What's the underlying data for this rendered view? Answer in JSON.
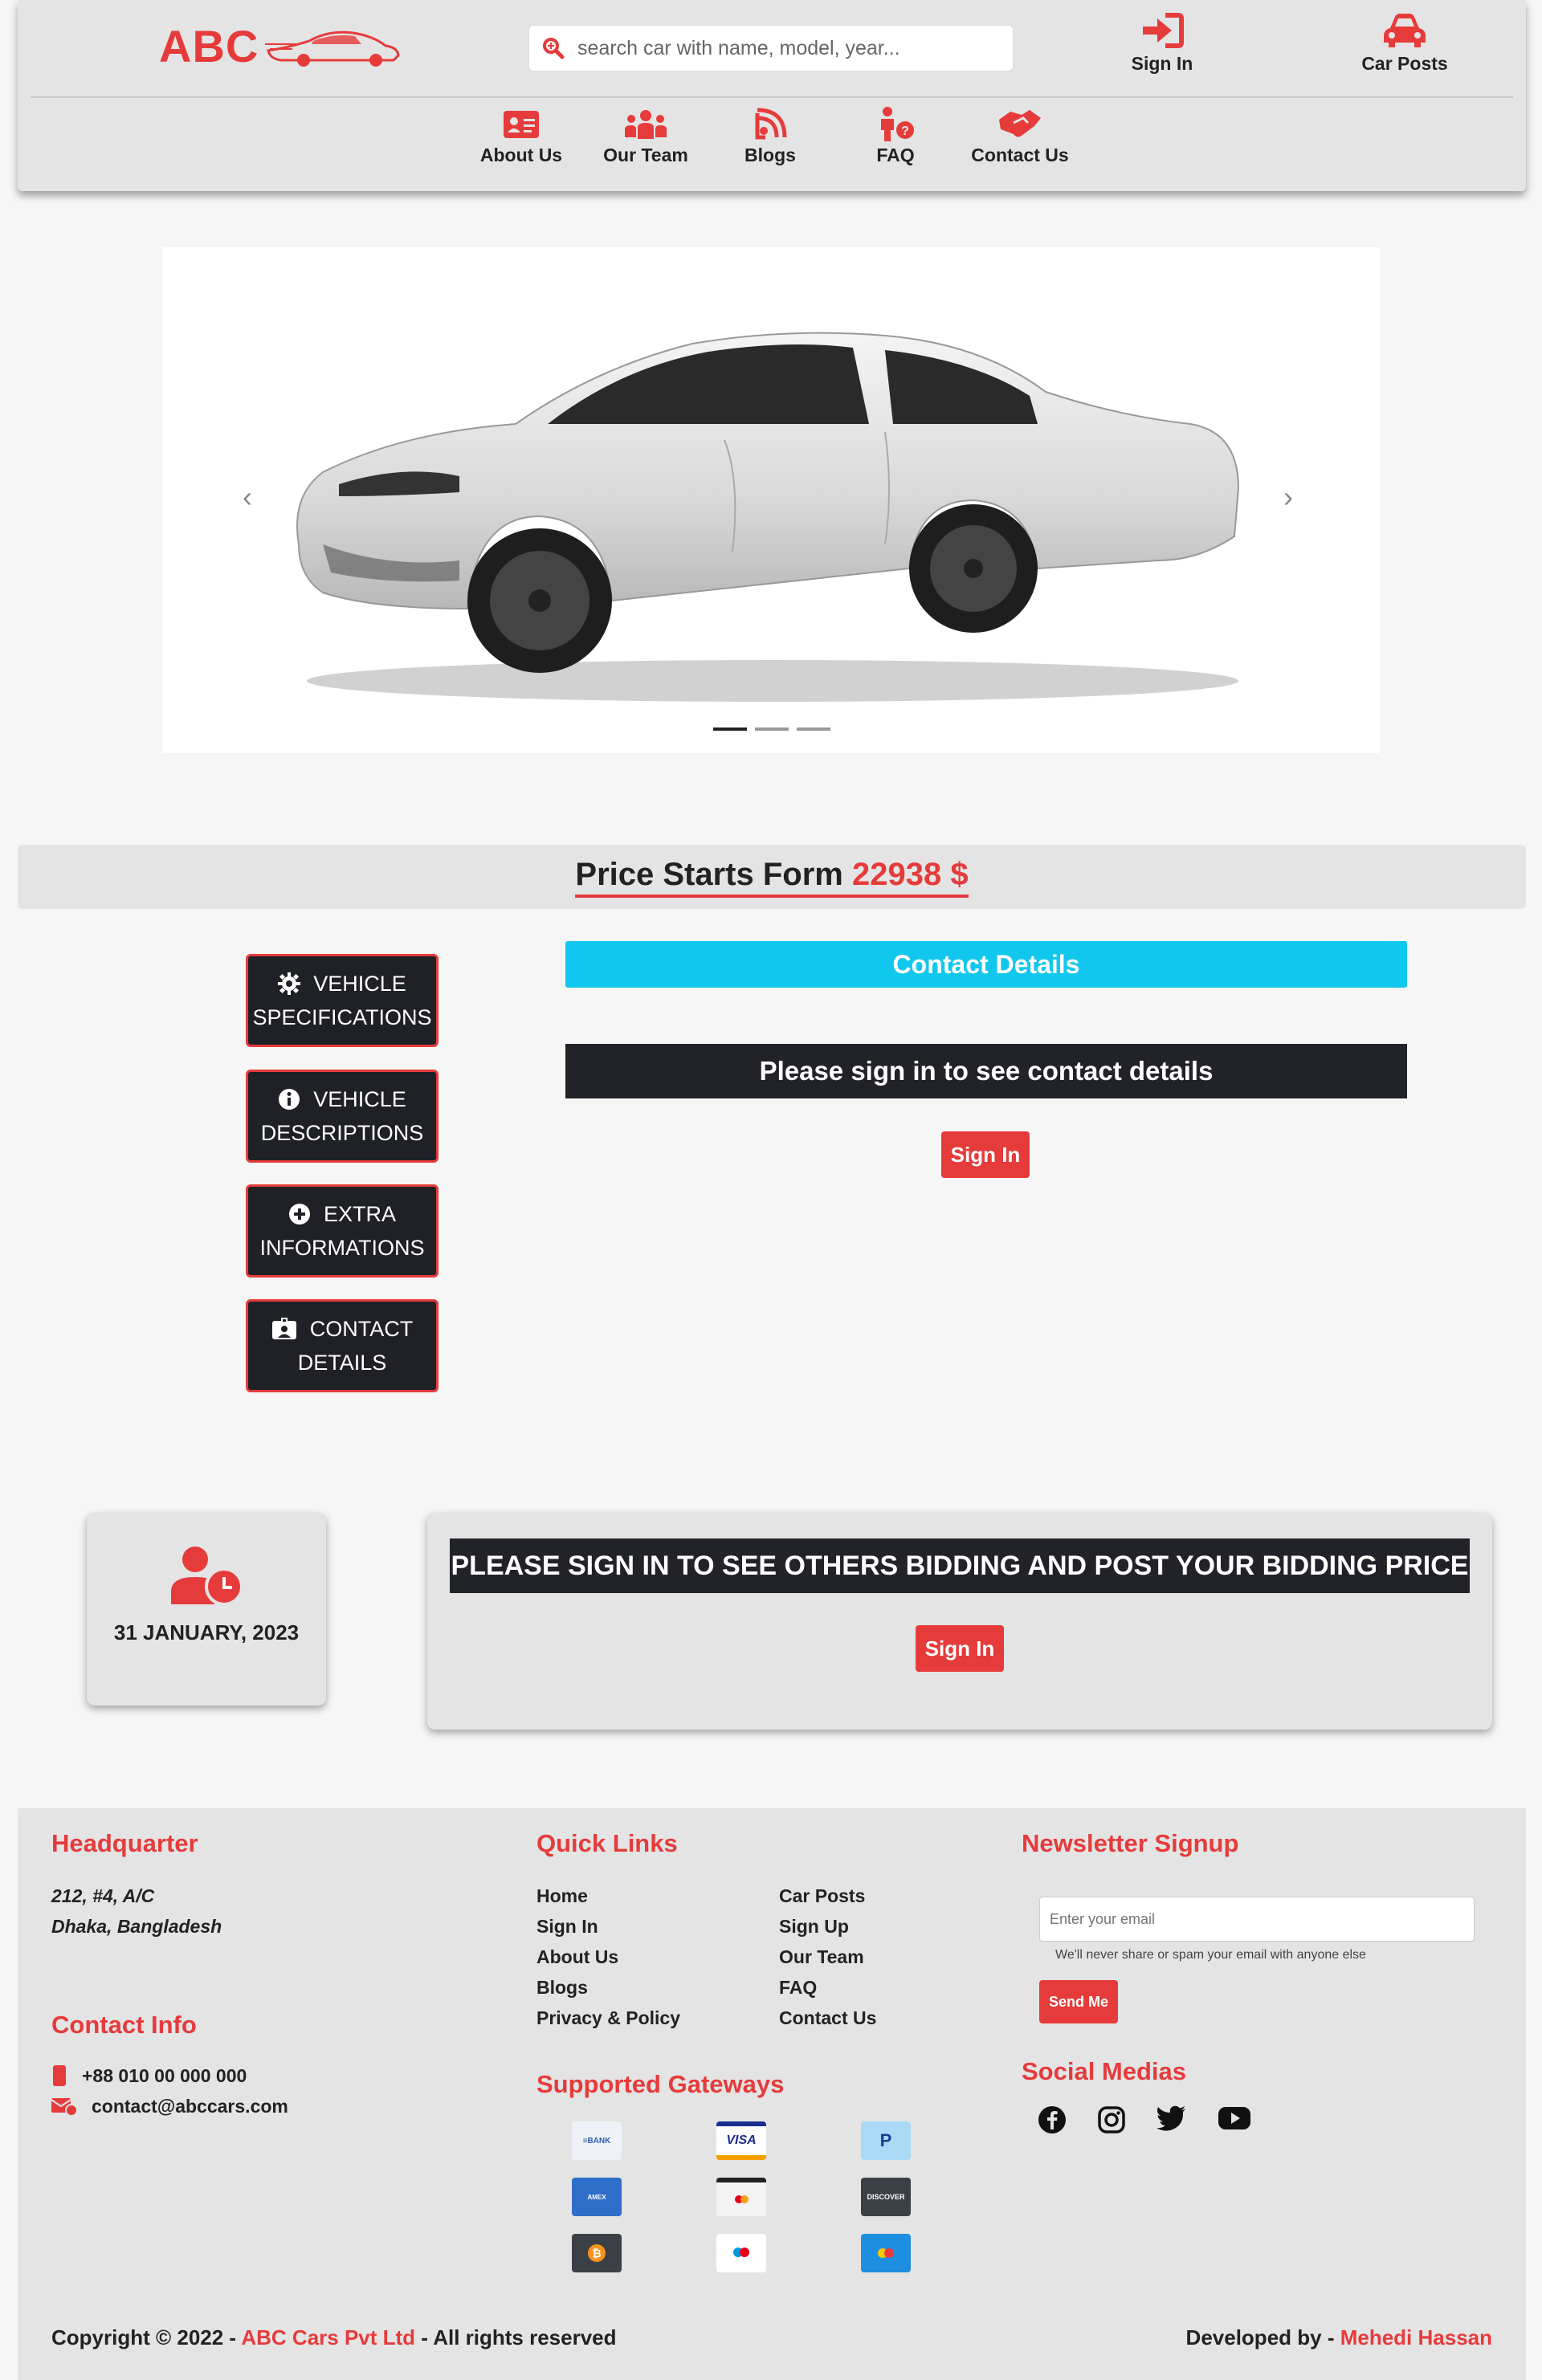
{
  "header": {
    "logo_text": "ABC",
    "search_placeholder": "search car with name, model, year...",
    "sign_in": "Sign In",
    "car_posts": "Car Posts",
    "nav": [
      {
        "label": "About Us",
        "icon": "id-card-icon"
      },
      {
        "label": "Our Team",
        "icon": "people-icon"
      },
      {
        "label": "Blogs",
        "icon": "rss-icon"
      },
      {
        "label": "FAQ",
        "icon": "person-question-icon"
      },
      {
        "label": "Contact Us",
        "icon": "handshake-icon"
      }
    ]
  },
  "carousel": {
    "prev": "‹",
    "next": "›",
    "slides": 3,
    "active_slide": 1
  },
  "price": {
    "label": "Price Starts Form",
    "value": "22938 $"
  },
  "side_buttons": [
    {
      "line1": "VEHICLE",
      "line2": "SPECIFICATIONS",
      "icon": "gear-icon"
    },
    {
      "line1": "VEHICLE",
      "line2": "DESCRIPTIONS",
      "icon": "info-icon"
    },
    {
      "line1": "EXTRA",
      "line2": "INFORMATIONS",
      "icon": "plus-circle-icon"
    },
    {
      "line1": "CONTACT",
      "line2": "DETAILS",
      "icon": "contact-card-icon"
    }
  ],
  "contact": {
    "heading": "Contact Details",
    "message": "Please sign in to see contact details",
    "button": "Sign In"
  },
  "post_date": "31 JANUARY, 2023",
  "bidding": {
    "message": "PLEASE SIGN IN TO SEE OTHERS BIDDING AND POST YOUR BIDDING PRICE",
    "button": "Sign In"
  },
  "footer": {
    "hq_title": "Headquarter",
    "hq_line1": "212, #4, A/C",
    "hq_line2": "Dhaka, Bangladesh",
    "contact_title": "Contact Info",
    "phone": "+88 010 00 000 000",
    "email": "contact@abccars.com",
    "quick_title": "Quick Links",
    "quick_col1": [
      "Home",
      "Sign In",
      "About Us",
      "Blogs",
      "Privacy & Policy"
    ],
    "quick_col2": [
      "Car Posts",
      "Sign Up",
      "Our Team",
      "FAQ",
      "Contact Us"
    ],
    "gateways_title": "Supported Gateways",
    "newsletter_title": "Newsletter Signup",
    "newsletter_placeholder": "Enter your email",
    "newsletter_help": "We'll never share or spam your email with anyone else",
    "newsletter_button": "Send Me",
    "social_title": "Social Medias",
    "copyright_prefix": "Copyright © 2022 - ",
    "copyright_company": "ABC Cars Pvt Ltd",
    "copyright_suffix": " - All rights reserved",
    "developed_prefix": "Developed by - ",
    "developer": "Mehedi Hassan"
  },
  "colors": {
    "accent": "#e63b3b",
    "dark": "#212328",
    "cyan": "#12c7ee",
    "panel": "#e4e4e4"
  }
}
